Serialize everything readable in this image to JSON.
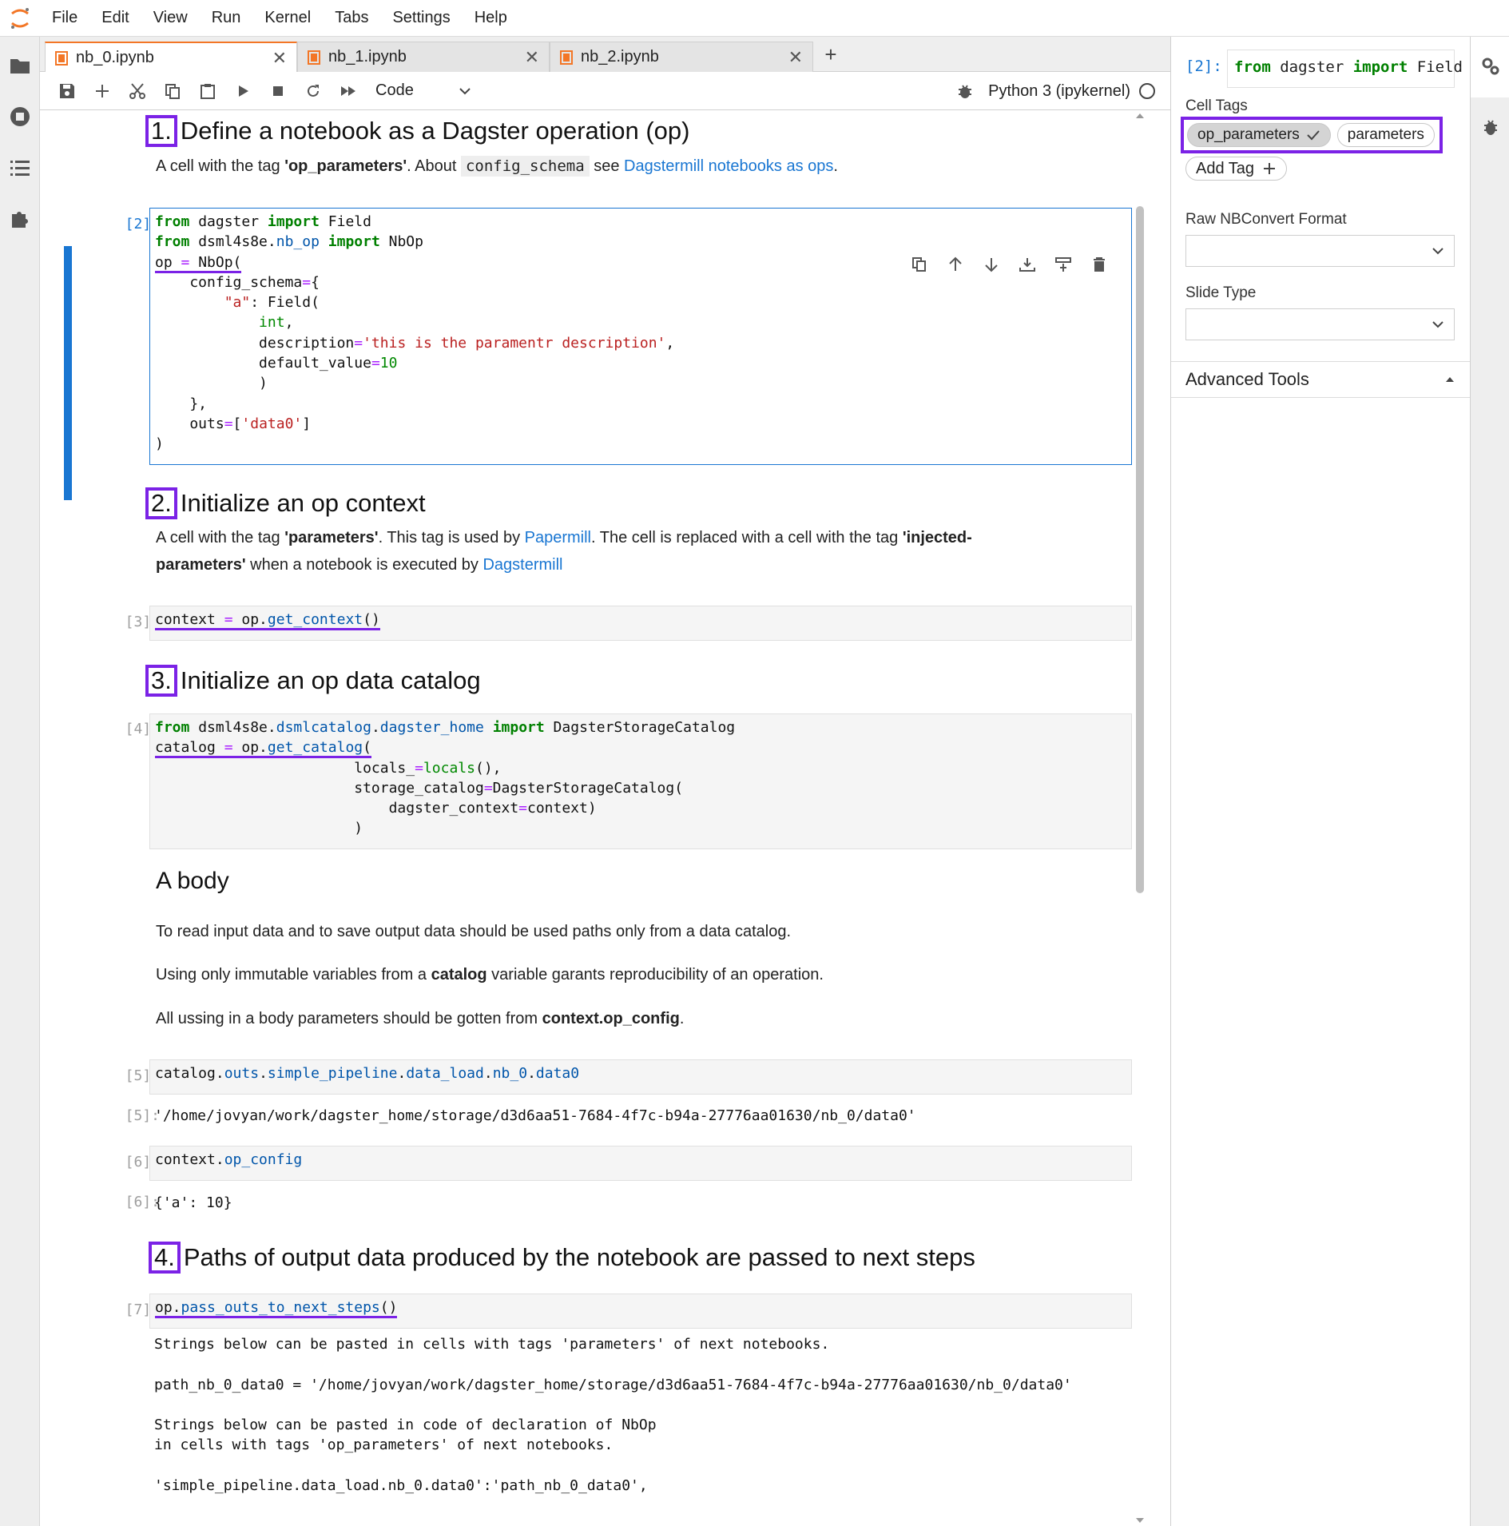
{
  "menu": [
    "File",
    "Edit",
    "View",
    "Run",
    "Kernel",
    "Tabs",
    "Settings",
    "Help"
  ],
  "tabs": [
    {
      "label": "nb_0.ipynb",
      "active": true
    },
    {
      "label": "nb_1.ipynb",
      "active": false
    },
    {
      "label": "nb_2.ipynb",
      "active": false
    }
  ],
  "toolbar": {
    "cell_type": "Code",
    "kernel": "Python 3 (ipykernel)"
  },
  "colors": {
    "accent": "#1976d2",
    "highlight": "#7b22e6",
    "jupyter_orange": "#f37626"
  },
  "notebook": {
    "h1": {
      "num": "1.",
      "text": "Define a notebook as a Dagster operation (op)"
    },
    "p1": {
      "pre": "A cell with the tag ",
      "tag": "'op_parameters'",
      "mid": ". About ",
      "code": "config_schema",
      "post": " see ",
      "link": "Dagstermill notebooks as ops",
      "end": "."
    },
    "cell2_prompt": "[2]:",
    "h2": {
      "num": "2.",
      "text": "Initialize an op context"
    },
    "p2": {
      "pre": "A cell with the tag ",
      "tag": "'parameters'",
      "mid": ". This tag is used by ",
      "link1": "Papermill",
      "mid2": ". The cell is replaced with a cell with the tag ",
      "tag2a": "'injected-",
      "tag2b": "parameters'",
      "mid3": " when a notebook is executed by ",
      "link2": "Dagstermill"
    },
    "cell3_prompt": "[3]:",
    "h3": {
      "num": "3.",
      "text": "Initialize an op data catalog"
    },
    "cell4_prompt": "[4]:",
    "h_body": "A body",
    "body_p1": "To read input data and to save output data should be used paths only from a data catalog.",
    "body_p2": {
      "pre": "Using only immutable variables from a ",
      "b": "catalog",
      "post": " variable garants reproducibility of an operation."
    },
    "body_p3": {
      "pre": "All ussing in a body parameters should be gotten from ",
      "b": "context.op_config",
      "post": "."
    },
    "cell5_prompt": "[5]:",
    "out5_prompt": "[5]:",
    "out5": "'/home/jovyan/work/dagster_home/storage/d3d6aa51-7684-4f7c-b94a-27776aa01630/nb_0/data0'",
    "cell6_prompt": "[6]:",
    "out6_prompt": "[6]:",
    "out6": "{'a': 10}",
    "h4": {
      "num": "4.",
      "text": "Paths of output data produced by the notebook are passed to next steps"
    },
    "cell7_prompt": "[7]:",
    "out7": [
      "Strings below can be pasted in cells with tags 'parameters' of next notebooks.",
      "",
      "path_nb_0_data0 = '/home/jovyan/work/dagster_home/storage/d3d6aa51-7684-4f7c-b94a-27776aa01630/nb_0/data0'",
      "",
      "Strings below can be pasted in code of declaration of NbOp",
      "in cells with tags 'op_parameters' of next notebooks.",
      "",
      "'simple_pipeline.data_load.nb_0.data0':'path_nb_0_data0',"
    ]
  },
  "right_panel": {
    "prompt": "[2]:",
    "cell_tags_label": "Cell Tags",
    "tags": [
      "op_parameters",
      "parameters"
    ],
    "add_tag": "Add Tag",
    "raw_format_label": "Raw NBConvert Format",
    "slide_type_label": "Slide Type",
    "advanced_tools": "Advanced Tools"
  }
}
